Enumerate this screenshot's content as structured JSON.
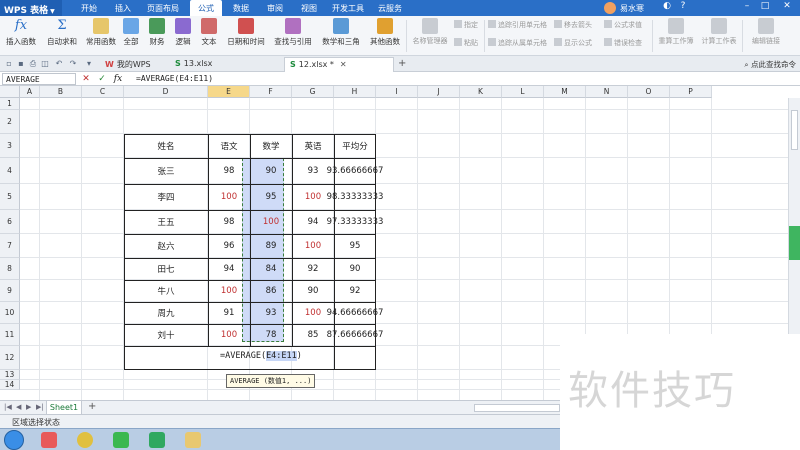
{
  "app": {
    "name": "WPS 表格"
  },
  "menu_tabs": [
    "开始",
    "插入",
    "页面布局",
    "公式",
    "数据",
    "审阅",
    "视图",
    "开发工具",
    "云服务"
  ],
  "active_menu_tab": "公式",
  "user": {
    "name": "易水寒"
  },
  "ribbon": {
    "buttons": [
      "插入函数",
      "自动求和",
      "常用函数",
      "全部",
      "财务",
      "逻辑",
      "文本",
      "日期和时间",
      "查找与引用",
      "数学和三角",
      "其他函数",
      "名称管理器"
    ],
    "small_items": [
      "指定",
      "粘贴",
      "追踪引用单元格",
      "追踪从属单元格",
      "移去箭头",
      "显示公式",
      "公式求值",
      "错误检查",
      "重算工作簿",
      "计算工作表",
      "编辑链接"
    ]
  },
  "doc_tabs": [
    {
      "label": "我的WPS"
    },
    {
      "label": "13.xlsx"
    },
    {
      "label": "12.xlsx *"
    }
  ],
  "right_hint": "点此查找命令",
  "formula_bar": {
    "name_box": "AVERAGE",
    "formula": "=AVERAGE(E4:E11)"
  },
  "columns": [
    "A",
    "B",
    "C",
    "D",
    "E",
    "F",
    "G",
    "H",
    "I",
    "J",
    "K",
    "L",
    "M",
    "N",
    "O",
    "P"
  ],
  "rows": [
    "1",
    "2",
    "3",
    "4",
    "5",
    "6",
    "7",
    "8",
    "9",
    "10",
    "11",
    "12",
    "13",
    "14"
  ],
  "table": {
    "headers": [
      "姓名",
      "语文",
      "数学",
      "英语",
      "平均分"
    ],
    "rows": [
      [
        "张三",
        "98",
        "90",
        "93",
        "93.66666667"
      ],
      [
        "李四",
        "100",
        "95",
        "100",
        "98.33333333"
      ],
      [
        "王五",
        "98",
        "100",
        "94",
        "97.33333333"
      ],
      [
        "赵六",
        "96",
        "89",
        "100",
        "95"
      ],
      [
        "田七",
        "94",
        "84",
        "92",
        "90"
      ],
      [
        "牛八",
        "100",
        "86",
        "90",
        "92"
      ],
      [
        "周九",
        "91",
        "93",
        "100",
        "94.66666667"
      ],
      [
        "刘十",
        "100",
        "78",
        "85",
        "87.66666667"
      ]
    ]
  },
  "edit_cell": {
    "prefix": "=AVERAGE(",
    "ref": "E4:E11",
    "suffix": ")"
  },
  "tooltip": "AVERAGE (数值1, ...)",
  "sheet_tabs": [
    "Sheet1"
  ],
  "status": "区域选择状态",
  "watermark": "软件技巧"
}
